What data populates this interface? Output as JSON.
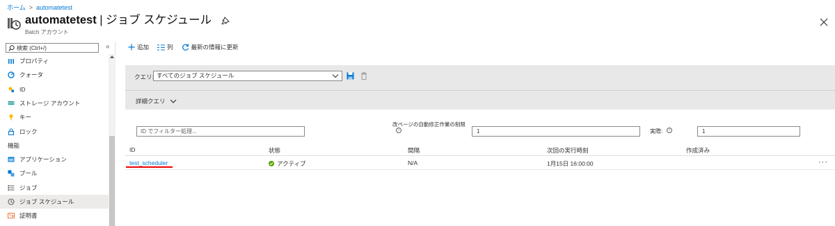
{
  "breadcrumb": {
    "home": "ホーム",
    "current": "automatetest"
  },
  "header": {
    "title_bold": "automatetest",
    "title_rest": " | ジョブ スケジュール",
    "subtitle": "Batch アカウント"
  },
  "sidebar": {
    "search_placeholder": "検索 (Ctrl+/)",
    "collapse": "«",
    "items": [
      {
        "label": "プロパティ",
        "icon": "properties-icon"
      },
      {
        "label": "クォータ",
        "icon": "quota-icon"
      },
      {
        "label": "ID",
        "icon": "identity-icon"
      },
      {
        "label": "ストレージ アカウント",
        "icon": "storage-icon"
      },
      {
        "label": "キー",
        "icon": "key-icon"
      },
      {
        "label": "ロック",
        "icon": "lock-icon"
      }
    ],
    "section": "機能",
    "feature_items": [
      {
        "label": "アプリケーション",
        "icon": "application-icon"
      },
      {
        "label": "プール",
        "icon": "pool-icon"
      },
      {
        "label": "ジョブ",
        "icon": "job-icon"
      },
      {
        "label": "ジョブ スケジュール",
        "icon": "job-schedule-icon",
        "selected": true
      },
      {
        "label": "証明書",
        "icon": "certificate-icon"
      }
    ]
  },
  "toolbar": {
    "add": "追加",
    "columns": "列",
    "refresh": "最新の情報に更新"
  },
  "query": {
    "label": "クエリ:",
    "selected": "すべてのジョブ スケジュール",
    "advanced": "詳細クエリ"
  },
  "filter": {
    "placeholder": "ID でフィルター処理...",
    "limit_label": "改ページの自動修正作業の制限",
    "limit_value": "1",
    "actual_label": "実際:",
    "actual_value": "1"
  },
  "table": {
    "headers": [
      "ID",
      "状態",
      "間隔",
      "次回の実行時刻",
      "作成済み"
    ],
    "rows": [
      {
        "id": "test_scheduler",
        "status": "アクティブ",
        "interval": "N/A",
        "next_run": "1月15日 16:00:00",
        "created": ""
      }
    ],
    "more": "···"
  },
  "colors": {
    "accent": "#0078d4",
    "active": "#57a300",
    "highlight": "#e00000"
  }
}
